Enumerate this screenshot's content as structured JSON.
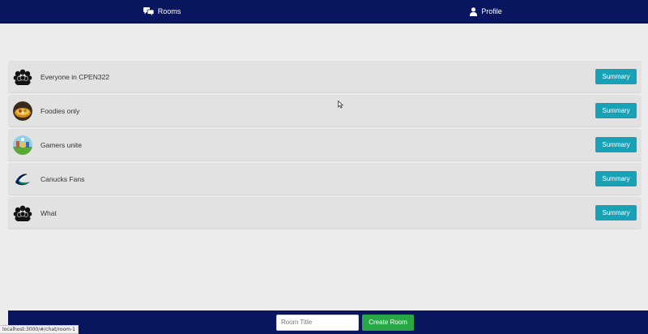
{
  "nav": {
    "rooms_label": "Rooms",
    "profile_label": "Profile",
    "rooms_icon": "chat-bubbles-icon",
    "profile_icon": "user-icon"
  },
  "rooms": [
    {
      "name": "Everyone in CPEN322",
      "icon": "group-icon",
      "button": "Summary"
    },
    {
      "name": "Foodies only",
      "icon": "food-icon",
      "button": "Summary"
    },
    {
      "name": "Gamers unite",
      "icon": "game-icon",
      "button": "Summary"
    },
    {
      "name": "Canucks Fans",
      "icon": "canucks-logo-icon",
      "button": "Summary"
    },
    {
      "name": "What",
      "icon": "group-icon",
      "button": "Summary"
    }
  ],
  "footer": {
    "room_title_placeholder": "Room Title",
    "room_title_value": "",
    "create_label": "Create Room"
  },
  "status_bar": {
    "url": "localhost:3000/#/chat/room-1"
  },
  "colors": {
    "nav_bg": "#0a1560",
    "summary_btn": "#17a2b8",
    "create_btn": "#28a745",
    "page_bg": "#ececec"
  }
}
